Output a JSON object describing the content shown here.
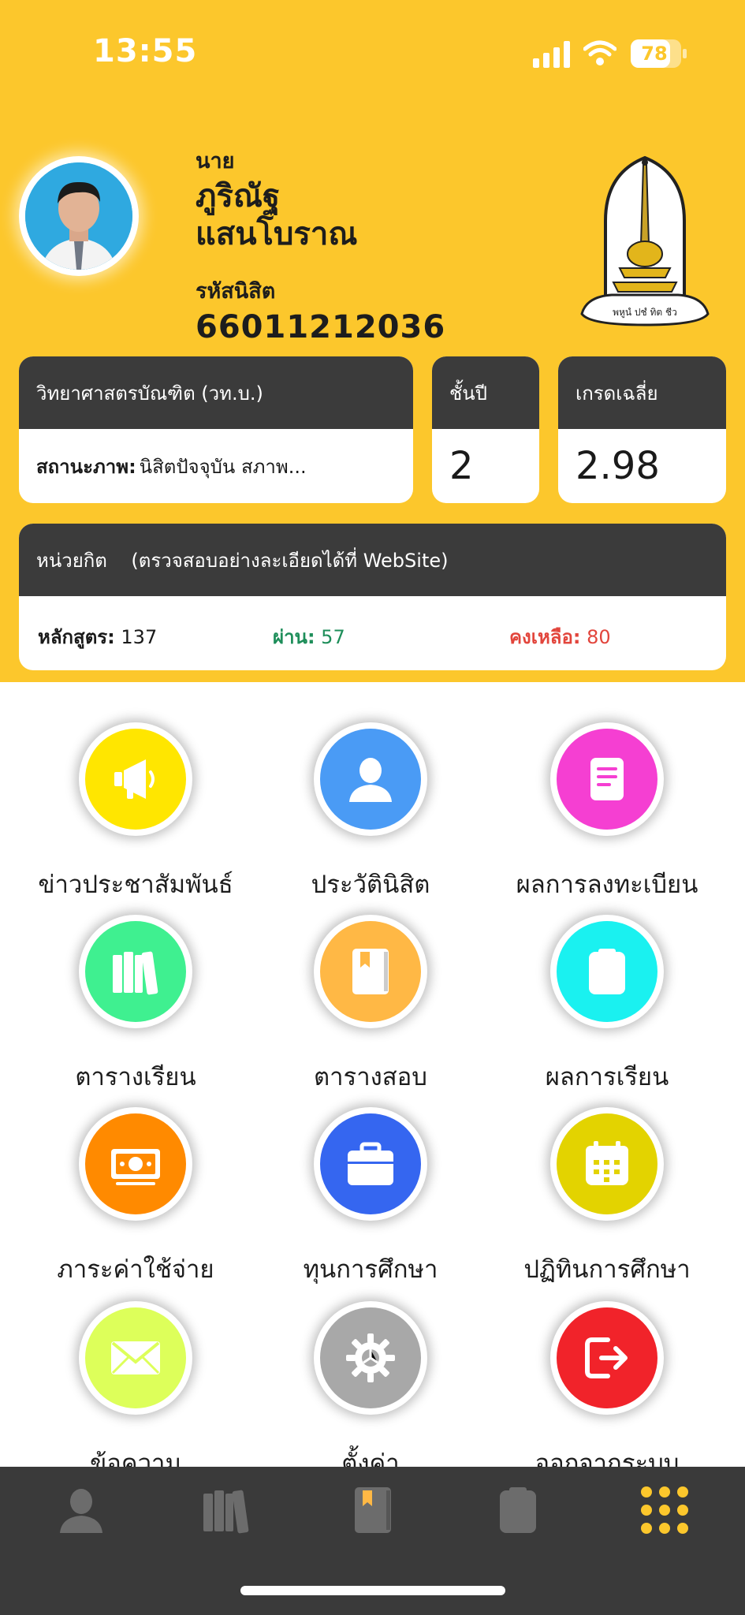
{
  "status_bar": {
    "time": "13:55",
    "battery": "78",
    "battery_level": 0.78
  },
  "profile": {
    "prefix": "นาย",
    "first_name": "ภูริณัฐ",
    "last_name": "แสนโบราณ",
    "student_id_label": "รหัสนิสิต",
    "student_id": "66011212036",
    "logo_caption": "พหูนํ ปชํ ทิต ชีว"
  },
  "degree_card": {
    "title": "วิทยาศาสตรบัณฑิต (วท.บ.)",
    "status_label": "สถานะภาพ:",
    "status_value": "นิสิตปัจจุบัน สภาพ..."
  },
  "year_card": {
    "title": "ชั้นปี",
    "value": "2"
  },
  "gpa_card": {
    "title": "เกรดเฉลี่ย",
    "value": "2.98"
  },
  "credit_card": {
    "title": "หน่วยกิต    (ตรวจสอบอย่างละเอียดได้ที่ WebSite)",
    "total_label": "หลักสูตร:",
    "total_value": " 137",
    "pass_label": "ผ่าน:",
    "pass_value": " 57",
    "remain_label": "คงเหลือ:",
    "remain_value": " 80"
  },
  "menu": [
    {
      "label": "ข่าวประชาสัมพันธ์",
      "icon": "megaphone-icon",
      "color": "#FFE600"
    },
    {
      "label": "ประวัตินิสิต",
      "icon": "user-icon",
      "color": "#4A9BF5"
    },
    {
      "label": "ผลการลงทะเบียน",
      "icon": "document-icon",
      "color": "#F53FD2"
    },
    {
      "label": "ตารางเรียน",
      "icon": "books-icon",
      "color": "#3FF090"
    },
    {
      "label": "ตารางสอบ",
      "icon": "book-icon",
      "color": "#FFB845"
    },
    {
      "label": "ผลการเรียน",
      "icon": "clipboard-icon",
      "color": "#1AF1F0"
    },
    {
      "label": "ภาระค่าใช้จ่าย",
      "icon": "money-icon",
      "color": "#FF8A00"
    },
    {
      "label": "ทุนการศึกษา",
      "icon": "briefcase-icon",
      "color": "#3566F0"
    },
    {
      "label": "ปฏิทินการศึกษา",
      "icon": "calendar-icon",
      "color": "#E3D300"
    },
    {
      "label": "ข้อความ",
      "icon": "mail-icon",
      "color": "#DDFF5A"
    },
    {
      "label": "ตั้งค่า",
      "icon": "gear-icon",
      "color": "#A8A8A8"
    },
    {
      "label": "ออกจากระบบ",
      "icon": "logout-icon",
      "color": "#F1232A"
    }
  ],
  "bottom_nav": [
    {
      "icon": "user-icon",
      "active": false
    },
    {
      "icon": "books-icon",
      "active": false
    },
    {
      "icon": "book-icon",
      "active": false
    },
    {
      "icon": "clipboard-icon",
      "active": false
    },
    {
      "icon": "grid-dots-icon",
      "active": true,
      "active_color": "#FCC72C"
    }
  ]
}
